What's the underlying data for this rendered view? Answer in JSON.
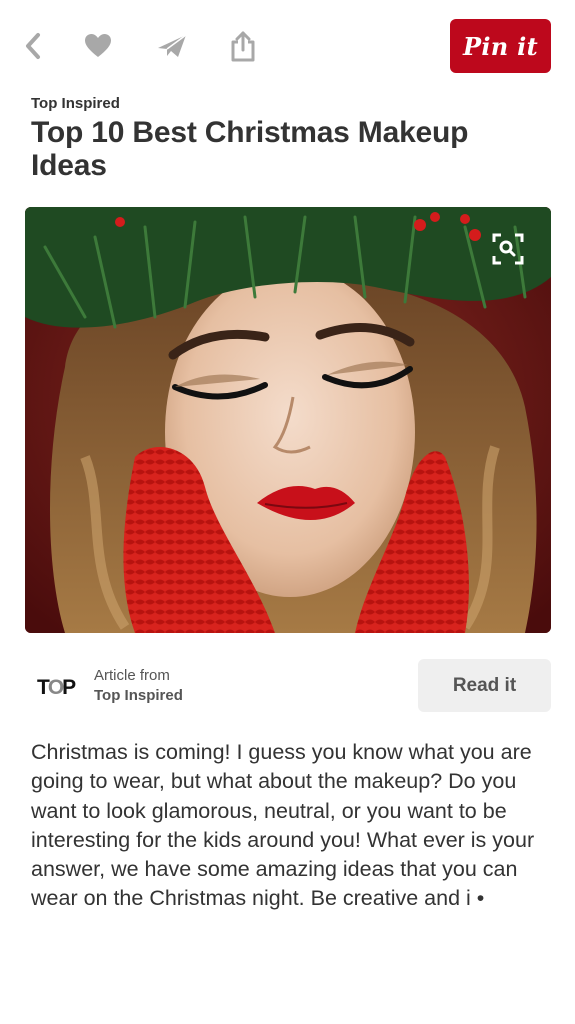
{
  "toolbar": {
    "back_icon": "chevron-left-icon",
    "like_icon": "heart-icon",
    "send_icon": "paper-plane-icon",
    "share_icon": "share-icon",
    "pin_label": "Pin it",
    "pin_color": "#bd081c"
  },
  "pin": {
    "source_label": "Top Inspired",
    "title": "Top 10 Best Christmas Makeup Ideas",
    "visual_search_icon": "visual-search-icon"
  },
  "attribution": {
    "logo_text_start": "T",
    "logo_text_mid": "O",
    "logo_text_end": "P",
    "article_from": "Article from",
    "source": "Top Inspired",
    "read_label": "Read it"
  },
  "description": "Christmas is coming! I guess you know what you are going to wear, but what about the makeup? Do you want to look glamorous, neutral, or you want to be interesting for the kids around you! What ever is your answer, we have some amazing ideas that you can wear on the Christmas night. Be creative and i •"
}
